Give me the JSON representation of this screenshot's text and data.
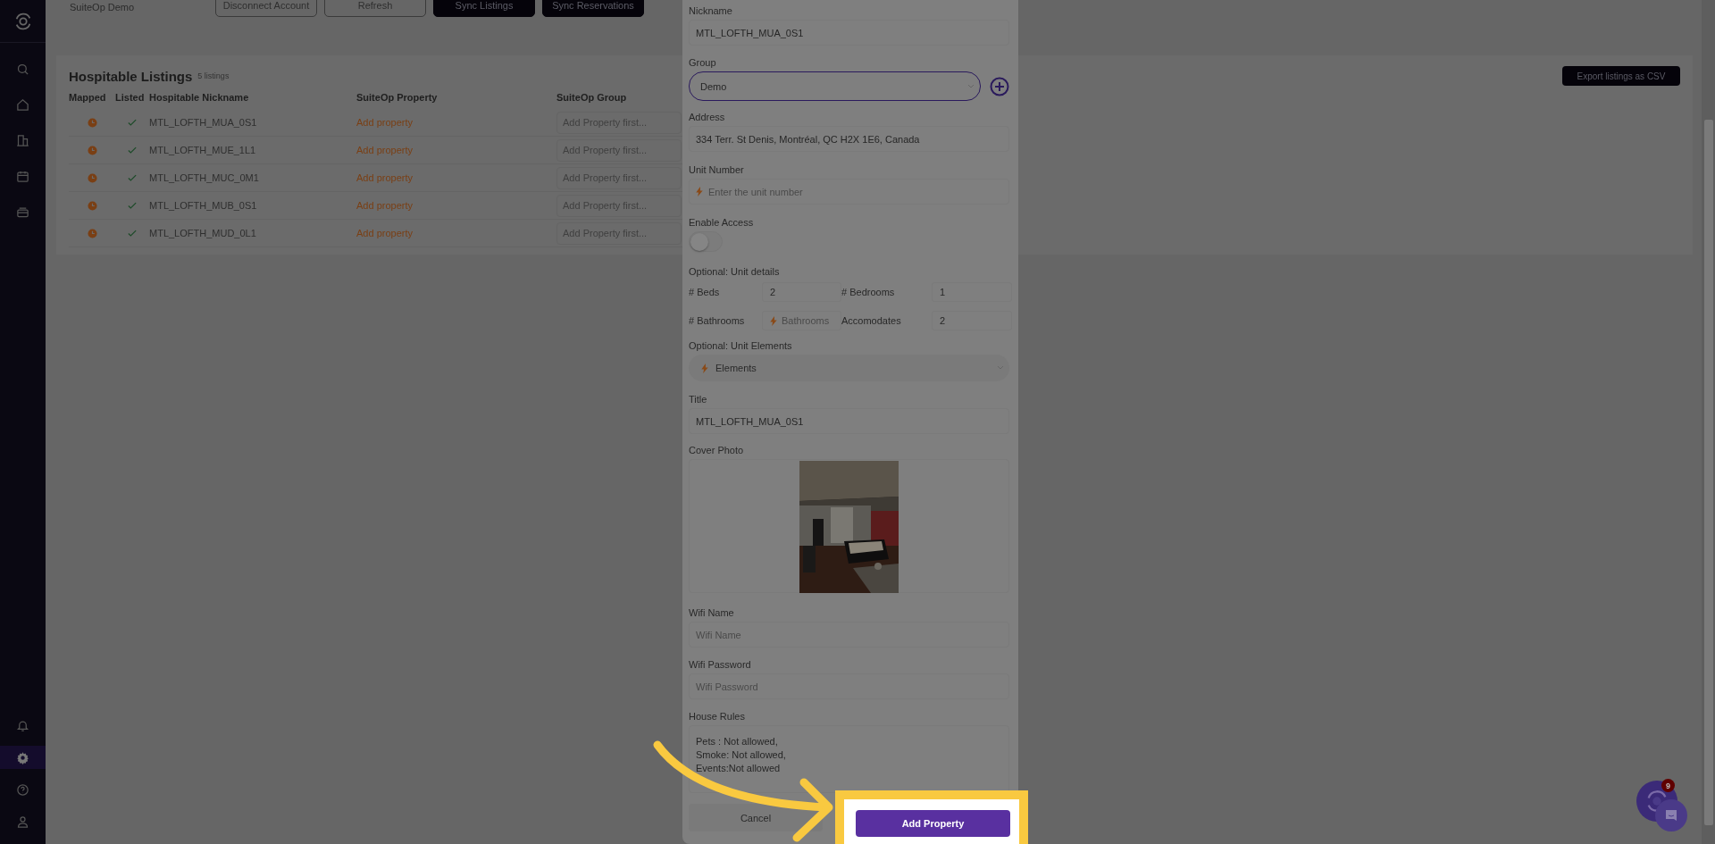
{
  "sidebar": {
    "top_items": [
      {
        "kind": "search",
        "selected": false
      },
      {
        "kind": "home",
        "selected": false
      },
      {
        "kind": "building",
        "selected": false
      },
      {
        "kind": "calendar",
        "selected": false
      },
      {
        "kind": "inbox",
        "selected": false
      }
    ],
    "bottom_items": [
      {
        "kind": "bell",
        "selected": false
      },
      {
        "kind": "gear",
        "selected": true
      },
      {
        "kind": "help",
        "selected": false
      },
      {
        "kind": "user",
        "selected": false
      }
    ]
  },
  "header": {
    "account": "SuiteOp Demo",
    "buttons": [
      {
        "label": "Disconnect Account",
        "kind": "outline"
      },
      {
        "label": "Refresh",
        "kind": "outline"
      },
      {
        "label": "Sync Listings",
        "kind": "solid"
      },
      {
        "label": "Sync Reservations",
        "kind": "solid"
      }
    ]
  },
  "listings": {
    "title": "Hospitable Listings",
    "count": "5 listings",
    "export_button": "Export listings as CSV",
    "columns": [
      "Mapped",
      "Listed",
      "Hospitable Nickname",
      "SuiteOp Property",
      "SuiteOp Group"
    ],
    "rows": [
      {
        "mapped": false,
        "listed": true,
        "nickname": "MTL_LOFTH_MUA_0S1",
        "property": "Add property",
        "group_placeholder": "Add Property first..."
      },
      {
        "mapped": false,
        "listed": true,
        "nickname": "MTL_LOFTH_MUE_1L1",
        "property": "Add property",
        "group_placeholder": "Add Property first..."
      },
      {
        "mapped": false,
        "listed": true,
        "nickname": "MTL_LOFTH_MUC_0M1",
        "property": "Add property",
        "group_placeholder": "Add Property first..."
      },
      {
        "mapped": false,
        "listed": true,
        "nickname": "MTL_LOFTH_MUB_0S1",
        "property": "Add property",
        "group_placeholder": "Add Property first..."
      },
      {
        "mapped": false,
        "listed": true,
        "nickname": "MTL_LOFTH_MUD_0L1",
        "property": "Add property",
        "group_placeholder": "Add Property first..."
      }
    ]
  },
  "modal": {
    "nickname": {
      "label": "Nickname",
      "value": "MTL_LOFTH_MUA_0S1"
    },
    "group": {
      "label": "Group",
      "value": "Demo"
    },
    "address": {
      "label": "Address",
      "value": "334 Terr. St Denis, Montréal, QC H2X 1E6, Canada"
    },
    "unit_number": {
      "label": "Unit Number",
      "placeholder": "Enter the unit number"
    },
    "enable_access": {
      "label": "Enable Access",
      "on": false
    },
    "unit_details": {
      "label": "Optional: Unit details",
      "fields": [
        {
          "label": "# Beds",
          "value": "2"
        },
        {
          "label": "# Bedrooms",
          "value": "1"
        },
        {
          "label": "# Bathrooms",
          "placeholder": "Bathrooms"
        },
        {
          "label": "Accomodates",
          "value": "2"
        }
      ]
    },
    "unit_elements": {
      "label": "Optional: Unit Elements",
      "placeholder": "Elements"
    },
    "title": {
      "label": "Title",
      "value": "MTL_LOFTH_MUA_0S1"
    },
    "cover_photo": {
      "label": "Cover Photo",
      "kind": "picture"
    },
    "wifi_name": {
      "label": "Wifi Name",
      "placeholder": "Wifi Name"
    },
    "wifi_password": {
      "label": "Wifi Password",
      "placeholder": "Wifi Password"
    },
    "house_rules": {
      "label": "House Rules",
      "value": "Pets : Not allowed,\nSmoke: Not allowed,\nEvents:Not allowed"
    },
    "cancel_button": "Cancel",
    "submit_button": "Add Property"
  },
  "chat": {
    "badge": "9"
  }
}
